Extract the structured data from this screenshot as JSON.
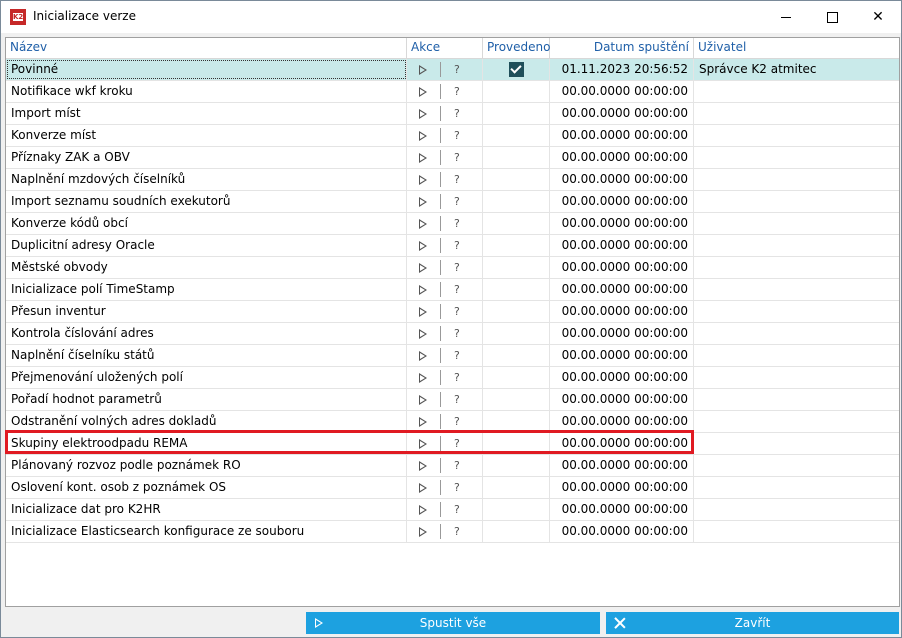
{
  "window": {
    "title": "Inicializace verze"
  },
  "columns": {
    "name": "Název",
    "action": "Akce",
    "done": "Provedeno",
    "date": "Datum spuštění",
    "user": "Uživatel"
  },
  "action_help": "?",
  "rows": [
    {
      "name": "Povinné",
      "done": true,
      "date": "01.11.2023 20:56:52",
      "user": "Správce K2 atmitec",
      "selected": true
    },
    {
      "name": "Notifikace wkf kroku",
      "done": false,
      "date": "00.00.0000 00:00:00",
      "user": ""
    },
    {
      "name": "Import míst",
      "done": false,
      "date": "00.00.0000 00:00:00",
      "user": ""
    },
    {
      "name": "Konverze míst",
      "done": false,
      "date": "00.00.0000 00:00:00",
      "user": ""
    },
    {
      "name": "Příznaky ZAK a OBV",
      "done": false,
      "date": "00.00.0000 00:00:00",
      "user": ""
    },
    {
      "name": "Naplnění mzdových číselníků",
      "done": false,
      "date": "00.00.0000 00:00:00",
      "user": ""
    },
    {
      "name": "Import seznamu soudních exekutorů",
      "done": false,
      "date": "00.00.0000 00:00:00",
      "user": ""
    },
    {
      "name": "Konverze kódů obcí",
      "done": false,
      "date": "00.00.0000 00:00:00",
      "user": ""
    },
    {
      "name": "Duplicitní adresy Oracle",
      "done": false,
      "date": "00.00.0000 00:00:00",
      "user": ""
    },
    {
      "name": "Městské obvody",
      "done": false,
      "date": "00.00.0000 00:00:00",
      "user": ""
    },
    {
      "name": "Inicializace polí TimeStamp",
      "done": false,
      "date": "00.00.0000 00:00:00",
      "user": ""
    },
    {
      "name": "Přesun inventur",
      "done": false,
      "date": "00.00.0000 00:00:00",
      "user": ""
    },
    {
      "name": "Kontrola číslování adres",
      "done": false,
      "date": "00.00.0000 00:00:00",
      "user": ""
    },
    {
      "name": "Naplnění číselníku států",
      "done": false,
      "date": "00.00.0000 00:00:00",
      "user": ""
    },
    {
      "name": "Přejmenování uložených polí",
      "done": false,
      "date": "00.00.0000 00:00:00",
      "user": ""
    },
    {
      "name": "Pořadí hodnot parametrů",
      "done": false,
      "date": "00.00.0000 00:00:00",
      "user": ""
    },
    {
      "name": "Odstranění volných adres dokladů",
      "done": false,
      "date": "00.00.0000 00:00:00",
      "user": ""
    },
    {
      "name": "Skupiny elektroodpadu REMA",
      "done": false,
      "date": "00.00.0000 00:00:00",
      "user": ""
    },
    {
      "name": "Plánovaný rozvoz podle poznámek RO",
      "done": false,
      "date": "00.00.0000 00:00:00",
      "user": ""
    },
    {
      "name": "Oslovení kont. osob z poznámek OS",
      "done": false,
      "date": "00.00.0000 00:00:00",
      "user": ""
    },
    {
      "name": "Inicializace dat pro K2HR",
      "done": false,
      "date": "00.00.0000 00:00:00",
      "user": ""
    },
    {
      "name": "Inicializace Elasticsearch konfigurace ze souboru",
      "done": false,
      "date": "00.00.0000 00:00:00",
      "user": ""
    }
  ],
  "buttons": {
    "run_all": "Spustit vše",
    "close": "Zavřít"
  },
  "highlight_row_name": "Skupiny elektroodpadu REMA",
  "colors": {
    "selected_row": "#c9eaea",
    "button": "#1da1e0",
    "header_text": "#1f5fa8",
    "highlight": "#e01a22"
  }
}
